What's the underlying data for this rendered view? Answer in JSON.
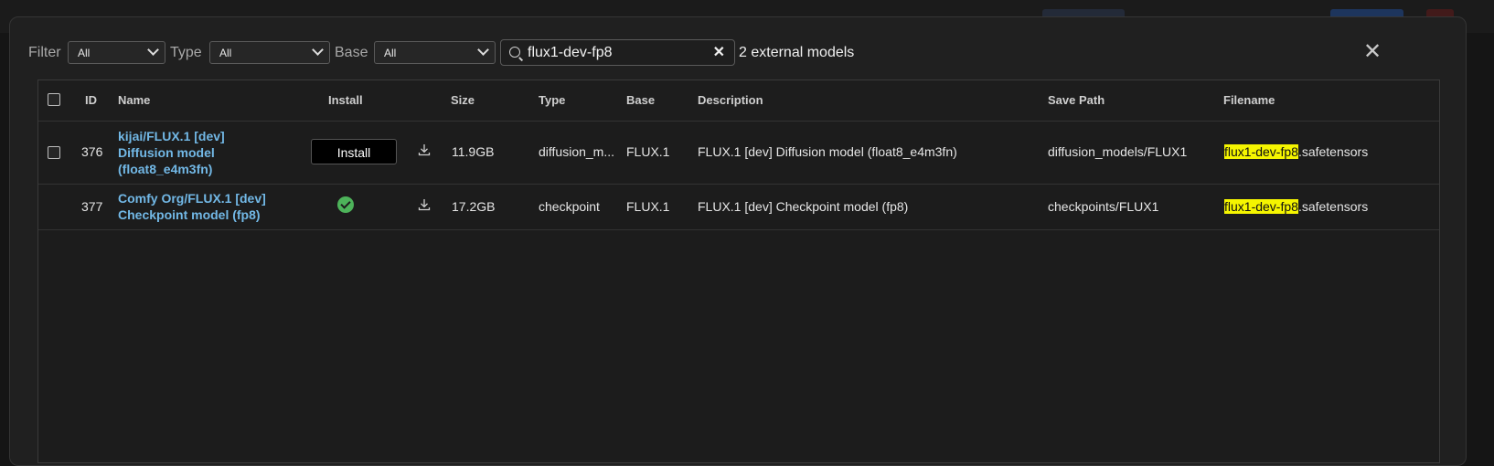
{
  "toolbar": {
    "filter_label": "Filter",
    "filter_value": "All",
    "type_label": "Type",
    "type_value": "All",
    "base_label": "Base",
    "base_value": "All",
    "search_value": "flux1-dev-fp8",
    "clear_glyph": "✕",
    "result_count": "2 external models",
    "close_glyph": "✕"
  },
  "table": {
    "headers": {
      "id": "ID",
      "name": "Name",
      "install": "Install",
      "size": "Size",
      "type": "Type",
      "base": "Base",
      "description": "Description",
      "save_path": "Save Path",
      "filename": "Filename"
    },
    "rows": [
      {
        "id": "376",
        "name": "kijai/FLUX.1 [dev] Diffusion model (float8_e4m3fn)",
        "install_label": "Install",
        "installed": false,
        "size": "11.9GB",
        "type": "diffusion_m...",
        "base": "FLUX.1",
        "description": "FLUX.1 [dev] Diffusion model (float8_e4m3fn)",
        "save_path": "diffusion_models/FLUX1",
        "filename_match": "flux1-dev-fp8",
        "filename_rest": ".safetensors"
      },
      {
        "id": "377",
        "name": "Comfy Org/FLUX.1 [dev] Checkpoint model (fp8)",
        "installed": true,
        "size": "17.2GB",
        "type": "checkpoint",
        "base": "FLUX.1",
        "description": "FLUX.1 [dev] Checkpoint model (fp8)",
        "save_path": "checkpoints/FLUX1",
        "filename_match": "flux1-dev-fp8",
        "filename_rest": ".safetensors"
      }
    ]
  },
  "colors": {
    "link": "#72b8e6",
    "highlight": "#f5f500",
    "installed_check": "#4db35a"
  },
  "icons": {
    "search": "search-icon",
    "download": "download-icon",
    "installed": "check-circle-icon",
    "close": "close-icon",
    "dropdown": "chevron-down-icon"
  }
}
